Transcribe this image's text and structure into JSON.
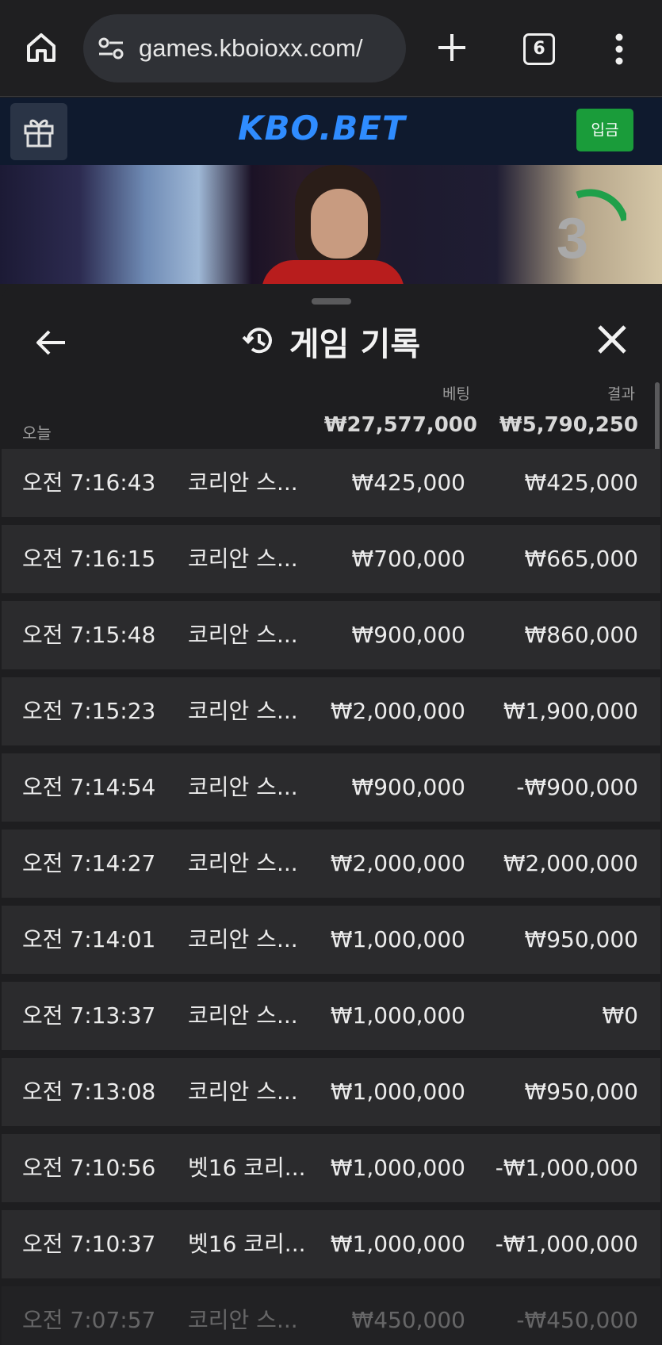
{
  "browser": {
    "url": "games.kboioxx.com/",
    "tab_count": "6"
  },
  "site": {
    "logo": "KBO.BET",
    "deposit_label": "입금"
  },
  "video": {
    "countdown": "3"
  },
  "history": {
    "title": "게임 기록",
    "columns": {
      "bet": "베팅",
      "result": "결과"
    },
    "period_label": "오늘",
    "total_bet": "₩27,577,000",
    "total_result": "₩5,790,250",
    "rows": [
      {
        "time": "오전 7:16:43",
        "game": "코리안 스...",
        "bet": "₩425,000",
        "result": "₩425,000"
      },
      {
        "time": "오전 7:16:15",
        "game": "코리안 스...",
        "bet": "₩700,000",
        "result": "₩665,000"
      },
      {
        "time": "오전 7:15:48",
        "game": "코리안 스...",
        "bet": "₩900,000",
        "result": "₩860,000"
      },
      {
        "time": "오전 7:15:23",
        "game": "코리안 스...",
        "bet": "₩2,000,000",
        "result": "₩1,900,000"
      },
      {
        "time": "오전 7:14:54",
        "game": "코리안 스...",
        "bet": "₩900,000",
        "result": "-₩900,000"
      },
      {
        "time": "오전 7:14:27",
        "game": "코리안 스...",
        "bet": "₩2,000,000",
        "result": "₩2,000,000"
      },
      {
        "time": "오전 7:14:01",
        "game": "코리안 스...",
        "bet": "₩1,000,000",
        "result": "₩950,000"
      },
      {
        "time": "오전 7:13:37",
        "game": "코리안 스...",
        "bet": "₩1,000,000",
        "result": "₩0"
      },
      {
        "time": "오전 7:13:08",
        "game": "코리안 스...",
        "bet": "₩1,000,000",
        "result": "₩950,000"
      },
      {
        "time": "오전 7:10:56",
        "game": "벳16 코리...",
        "bet": "₩1,000,000",
        "result": "-₩1,000,000"
      },
      {
        "time": "오전 7:10:37",
        "game": "벳16 코리...",
        "bet": "₩1,000,000",
        "result": "-₩1,000,000"
      },
      {
        "time": "오전 7:07:57",
        "game": "코리안 스...",
        "bet": "₩450,000",
        "result": "-₩450,000"
      }
    ]
  },
  "colors": {
    "brand_blue": "#2f8cff",
    "deposit_green": "#1a9c3a",
    "row_bg": "#2b2b2d"
  },
  "icons": [
    "home-icon",
    "site-settings-icon",
    "new-tab-icon",
    "menu-icon",
    "gift-icon",
    "back-arrow-icon",
    "history-icon",
    "close-icon"
  ]
}
